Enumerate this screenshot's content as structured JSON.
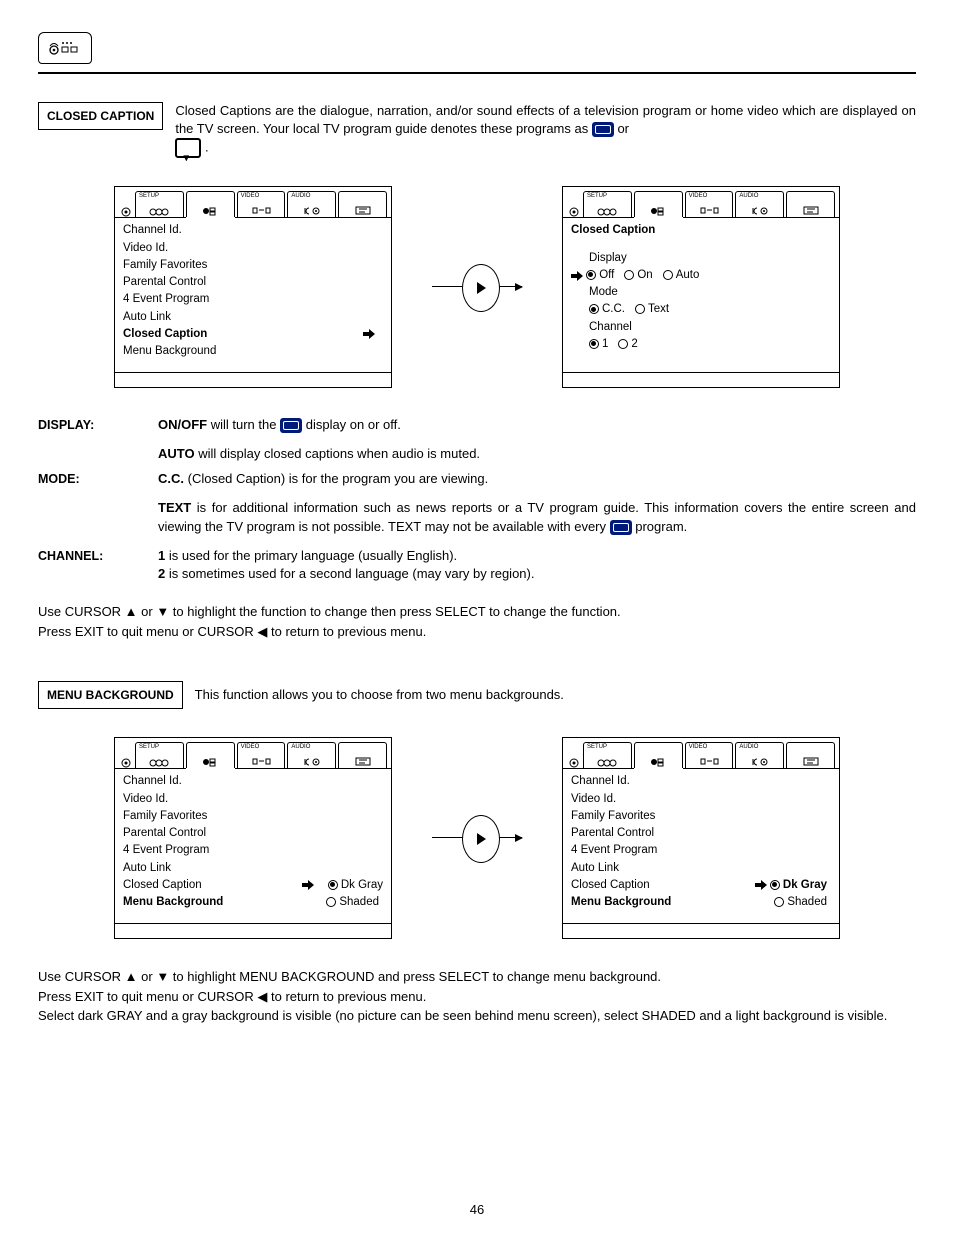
{
  "header": {
    "section1_label": "CLOSED CAPTION",
    "section2_label": "MENU BACKGROUND"
  },
  "intro": {
    "part1": "Closed Captions are the dialogue, narration, and/or sound effects of a television program or home video which are displayed on the TV screen.  Your local TV program guide denotes these programs as ",
    "part2": " or ",
    "part3": " ."
  },
  "tabs": [
    "SETUP",
    "",
    "VIDEO",
    "AUDIO",
    ""
  ],
  "menu_left": {
    "items": [
      "Channel Id.",
      "Video Id.",
      "Family Favorites",
      "Parental Control",
      "4 Event Program",
      "Auto Link",
      "Closed Caption",
      "Menu Background"
    ],
    "highlight_index": 6
  },
  "menu_right_cc": {
    "title": "Closed Caption",
    "rows": {
      "display": {
        "label": "Display",
        "opts": [
          "Off",
          "On",
          "Auto"
        ],
        "selected": 0,
        "pointer": true
      },
      "mode": {
        "label": "Mode",
        "opts": [
          "C.C.",
          "Text"
        ],
        "selected": 0
      },
      "channel": {
        "label": "Channel",
        "opts": [
          "1",
          "2"
        ],
        "selected": 0
      }
    }
  },
  "defs": {
    "display": {
      "label": "DISPLAY:",
      "onoff_bold": "ON/OFF",
      "onoff_rest": " will turn the ",
      "onoff_tail": " display on or off.",
      "auto_bold": "AUTO",
      "auto_rest": " will display closed captions when audio is muted."
    },
    "mode": {
      "label": "MODE:",
      "cc_bold": "C.C.",
      "cc_rest": " (Closed Caption) is for the program you are viewing.",
      "text_bold": "TEXT",
      "text_rest_a": " is for additional information such as news reports or a TV program guide.  This information covers the entire screen and viewing the TV program is not possible.  TEXT may not be available with every ",
      "text_rest_b": " program."
    },
    "channel": {
      "label": "CHANNEL:",
      "l1_bold": "1",
      "l1_rest": " is used for the primary language (usually English).",
      "l2_bold": "2",
      "l2_rest": " is sometimes used for a second language (may vary by region)."
    }
  },
  "nav1": {
    "l1": "Use CURSOR ▲ or ▼ to highlight the function to change then press SELECT to change the function.",
    "l2": "Press EXIT to quit menu or CURSOR ◀ to return to previous menu."
  },
  "menu_bg_intro": "This function allows you to choose from two menu backgrounds.",
  "menu_bg_panels": {
    "items": [
      "Channel Id.",
      "Video Id.",
      "Family Favorites",
      "Parental Control",
      "4 Event Program",
      "Auto Link",
      "Closed Caption",
      "Menu Background"
    ],
    "left_highlight_index": 7,
    "right_highlight_index": 7,
    "opts": [
      "Dk Gray",
      "Shaded"
    ],
    "left_selected": 0,
    "right_selected": 0
  },
  "nav2": {
    "l1": "Use CURSOR ▲ or ▼ to highlight MENU BACKGROUND and press SELECT to change menu background.",
    "l2": "Press EXIT to quit menu or CURSOR ◀ to return to previous menu.",
    "l3": "Select dark GRAY and a gray background is visible (no picture can be seen behind menu screen), select SHADED and a light background is visible."
  },
  "page_number": "46"
}
